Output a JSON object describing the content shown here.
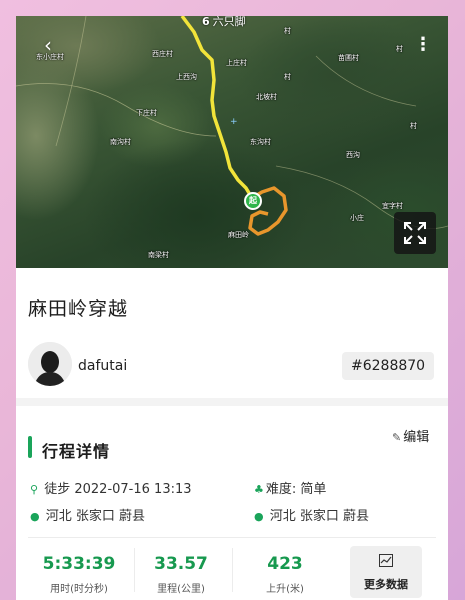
{
  "map": {
    "brand_icon": "6",
    "brand_text": "六只脚",
    "back_icon": "back-arrow-icon",
    "more_icon": "more-vertical-icon",
    "expand_icon": "expand-icon",
    "start_marker": "起",
    "labels": [
      "东小庄村",
      "西庄村",
      "村",
      "村",
      "上庄村",
      "苗圃村",
      "村",
      "上西沟",
      "北坡村",
      "下庄村",
      "南沟村",
      "东沟村",
      "西沟",
      "麻田岭",
      "宜字村",
      "小庄",
      "南梁村",
      "村"
    ],
    "colors": {
      "track_main": "#f2e43a",
      "track_loop": "#e8962c",
      "start_marker": "#2fb54a"
    }
  },
  "route": {
    "title": "麻田岭穿越",
    "username": "dafutai",
    "route_id": "#6288870"
  },
  "details": {
    "section_title": "行程详情",
    "edit_icon": "edit-icon",
    "edit_label": "编辑",
    "activity_icon": "hiking-icon",
    "activity_type": "徒步",
    "datetime": "2022-07-16 13:13",
    "difficulty_icon": "difficulty-icon",
    "difficulty_label": "难度:",
    "difficulty_value": "简单",
    "start_location_icon": "location-pin-icon",
    "start_location": "河北 张家口 蔚县",
    "end_location_icon": "location-pin-icon",
    "end_location": "河北 张家口 蔚县",
    "stats": [
      {
        "value": "5:33:39",
        "label": "用时(时分秒)"
      },
      {
        "value": "33.57",
        "label": "里程(公里)"
      },
      {
        "value": "423",
        "label": "上升(米)"
      }
    ],
    "more_data_icon": "chart-icon",
    "more_data_label": "更多数据",
    "accent_color": "#1aa45a"
  }
}
